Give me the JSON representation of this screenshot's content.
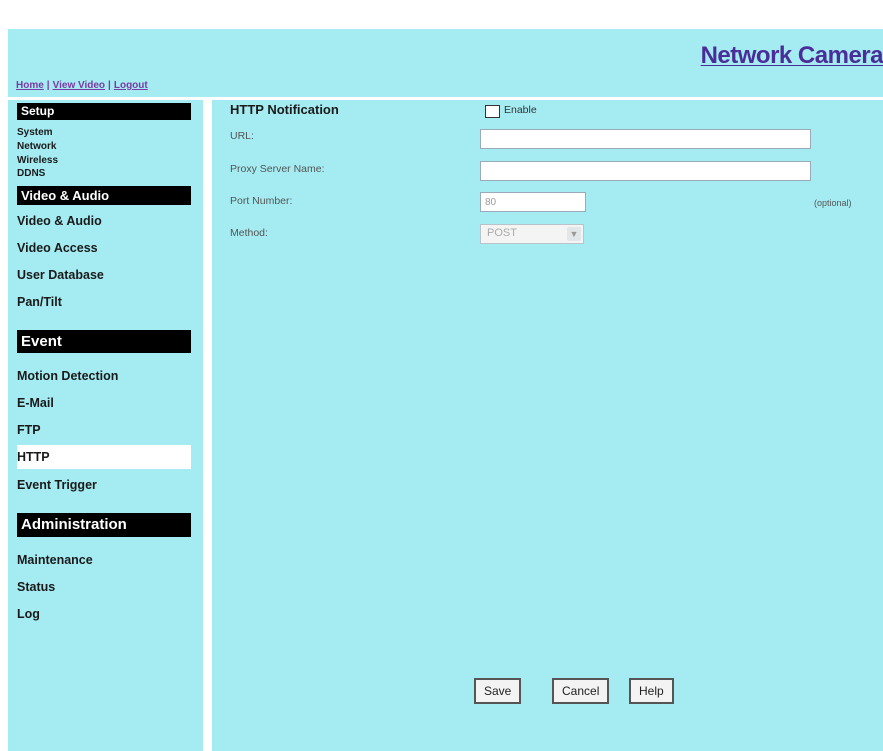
{
  "header": {
    "links": [
      {
        "label": "Home"
      },
      {
        "label": "View Video"
      },
      {
        "label": "Logout"
      }
    ],
    "separator": "|",
    "brand": "Network Camera"
  },
  "sidebar": {
    "sections": [
      {
        "title": "Setup",
        "items": [
          "System",
          "Network",
          "Wireless",
          "DDNS"
        ]
      },
      {
        "title": "Video & Audio",
        "items": [
          "Video & Audio",
          "Video Access",
          "User Database",
          "Pan/Tilt"
        ]
      },
      {
        "title": "Event",
        "items": [
          "Motion Detection",
          "E-Mail",
          "FTP",
          "HTTP",
          "Event Trigger"
        ]
      },
      {
        "title": "Administration",
        "items": [
          "Maintenance",
          "Status",
          "Log"
        ]
      }
    ],
    "active_item": "HTTP"
  },
  "form": {
    "title": "HTTP Notification",
    "enable_label": "Enable",
    "enable_checked": false,
    "url_label": "URL:",
    "url_value": "",
    "proxy_label": "Proxy Server Name:",
    "proxy_value": "",
    "proxy_hint": "(optional)",
    "port_label": "Port Number:",
    "port_value": "80",
    "method_label": "Method:",
    "method_value": "POST"
  },
  "buttons": {
    "save": "Save",
    "cancel": "Cancel",
    "help": "Help"
  }
}
